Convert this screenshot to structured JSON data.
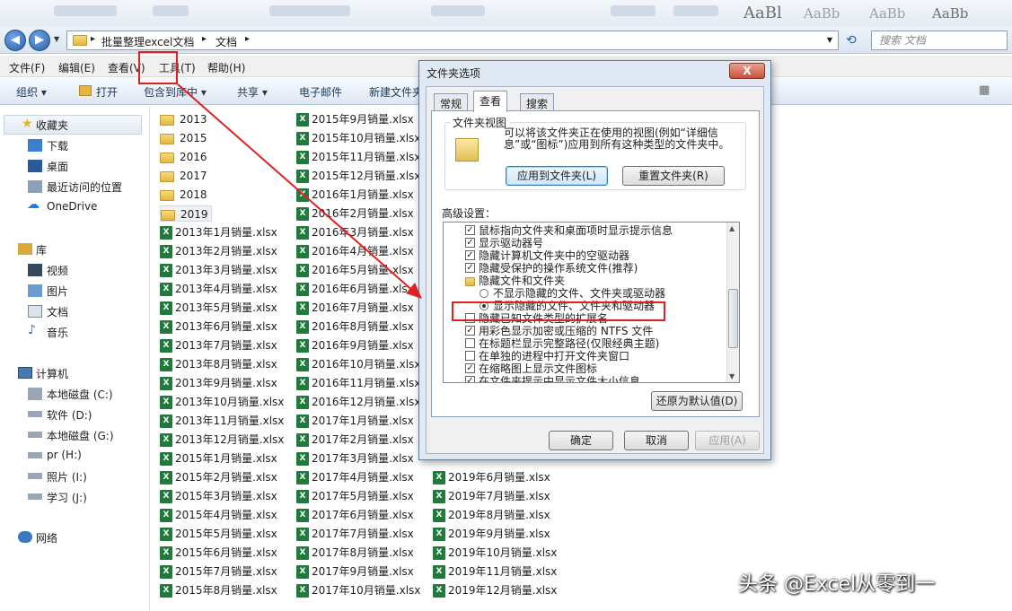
{
  "addressbar": {
    "crumb1": "批量整理excel文档",
    "crumb2": "文档",
    "search_placeholder": "搜索 文档"
  },
  "menu": [
    "文件(F)",
    "编辑(E)",
    "查看(V)",
    "工具(T)",
    "帮助(H)"
  ],
  "toolbar": [
    "组织 ▾",
    "打开",
    "包含到库中 ▾",
    "共享 ▾",
    "电子邮件",
    "新建文件夹"
  ],
  "nav": {
    "favorites": "收藏夹",
    "fav_items": [
      "下载",
      "桌面",
      "最近访问的位置",
      "OneDrive"
    ],
    "libraries": "库",
    "lib_items": [
      "视频",
      "图片",
      "文档",
      "音乐"
    ],
    "computer": "计算机",
    "drives": [
      "本地磁盘 (C:)",
      "软件 (D:)",
      "本地磁盘 (G:)",
      "pr (H:)",
      "照片 (I:)",
      "学习 (J:)"
    ],
    "network": "网络"
  },
  "files": {
    "col1": [
      "2013",
      "2015",
      "2016",
      "2017",
      "2018",
      "2019",
      "2013年1月销量.xlsx",
      "2013年2月销量.xlsx",
      "2013年3月销量.xlsx",
      "2013年4月销量.xlsx",
      "2013年5月销量.xlsx",
      "2013年6月销量.xlsx",
      "2013年7月销量.xlsx",
      "2013年8月销量.xlsx",
      "2013年9月销量.xlsx",
      "2013年10月销量.xlsx",
      "2013年11月销量.xlsx",
      "2013年12月销量.xlsx",
      "2015年1月销量.xlsx",
      "2015年2月销量.xlsx",
      "2015年3月销量.xlsx",
      "2015年4月销量.xlsx",
      "2015年5月销量.xlsx",
      "2015年6月销量.xlsx",
      "2015年7月销量.xlsx",
      "2015年8月销量.xlsx"
    ],
    "col2": [
      "2015年9月销量.xlsx",
      "2015年10月销量.xlsx",
      "2015年11月销量.xlsx",
      "2015年12月销量.xlsx",
      "2016年1月销量.xlsx",
      "2016年2月销量.xlsx",
      "2016年3月销量.xlsx",
      "2016年4月销量.xlsx",
      "2016年5月销量.xlsx",
      "2016年6月销量.xlsx",
      "2016年7月销量.xlsx",
      "2016年8月销量.xlsx",
      "2016年9月销量.xlsx",
      "2016年10月销量.xlsx",
      "2016年11月销量.xlsx",
      "2016年12月销量.xlsx",
      "2017年1月销量.xlsx",
      "2017年2月销量.xlsx",
      "2017年3月销量.xlsx",
      "2017年4月销量.xlsx",
      "2017年5月销量.xlsx",
      "2017年6月销量.xlsx",
      "2017年7月销量.xlsx",
      "2017年8月销量.xlsx",
      "2017年9月销量.xlsx",
      "2017年10月销量.xlsx"
    ],
    "col3": [
      "2019年6月销量.xlsx",
      "2019年7月销量.xlsx",
      "2019年8月销量.xlsx",
      "2019年9月销量.xlsx",
      "2019年10月销量.xlsx",
      "2019年11月销量.xlsx",
      "2019年12月销量.xlsx"
    ]
  },
  "dialog": {
    "title": "文件夹选项",
    "close": "X",
    "tabs": [
      "常规",
      "查看",
      "搜索"
    ],
    "folder_views_title": "文件夹视图",
    "folder_views_desc": "可以将该文件夹正在使用的视图(例如“详细信息”或“图标”)应用到所有这种类型的文件夹中。",
    "apply_btn": "应用到文件夹(L)",
    "reset_btn": "重置文件夹(R)",
    "advanced_title": "高级设置：",
    "advanced_items": [
      {
        "text": "鼠标指向文件夹和桌面项时显示提示信息",
        "type": "check",
        "checked": true
      },
      {
        "text": "显示驱动器号",
        "type": "check",
        "checked": true
      },
      {
        "text": "隐藏计算机文件夹中的空驱动器",
        "type": "check",
        "checked": true
      },
      {
        "text": "隐藏受保护的操作系统文件(推荐)",
        "type": "check",
        "checked": true
      },
      {
        "text": "隐藏文件和文件夹",
        "type": "folder",
        "checked": false
      },
      {
        "text": "不显示隐藏的文件、文件夹或驱动器",
        "type": "radio",
        "checked": false
      },
      {
        "text": "显示隐藏的文件、文件夹和驱动器",
        "type": "radio",
        "checked": true
      },
      {
        "text": "隐藏已知文件类型的扩展名",
        "type": "check",
        "checked": false
      },
      {
        "text": "用彩色显示加密或压缩的 NTFS 文件",
        "type": "check",
        "checked": true
      },
      {
        "text": "在标题栏显示完整路径(仅限经典主题)",
        "type": "check",
        "checked": false
      },
      {
        "text": "在单独的进程中打开文件夹窗口",
        "type": "check",
        "checked": false
      },
      {
        "text": "在缩略图上显示文件图标",
        "type": "check",
        "checked": true
      },
      {
        "text": "在文件夹提示中显示文件大小信息",
        "type": "check",
        "checked": true
      }
    ],
    "restore_btn": "还原为默认值(D)",
    "ok_btn": "确定",
    "cancel_btn": "取消",
    "apply2_btn": "应用(A)"
  },
  "watermark": "头条 @Excel从零到一",
  "colors": {
    "highlight": "#e02020",
    "excel_green": "#1f7a3c"
  }
}
